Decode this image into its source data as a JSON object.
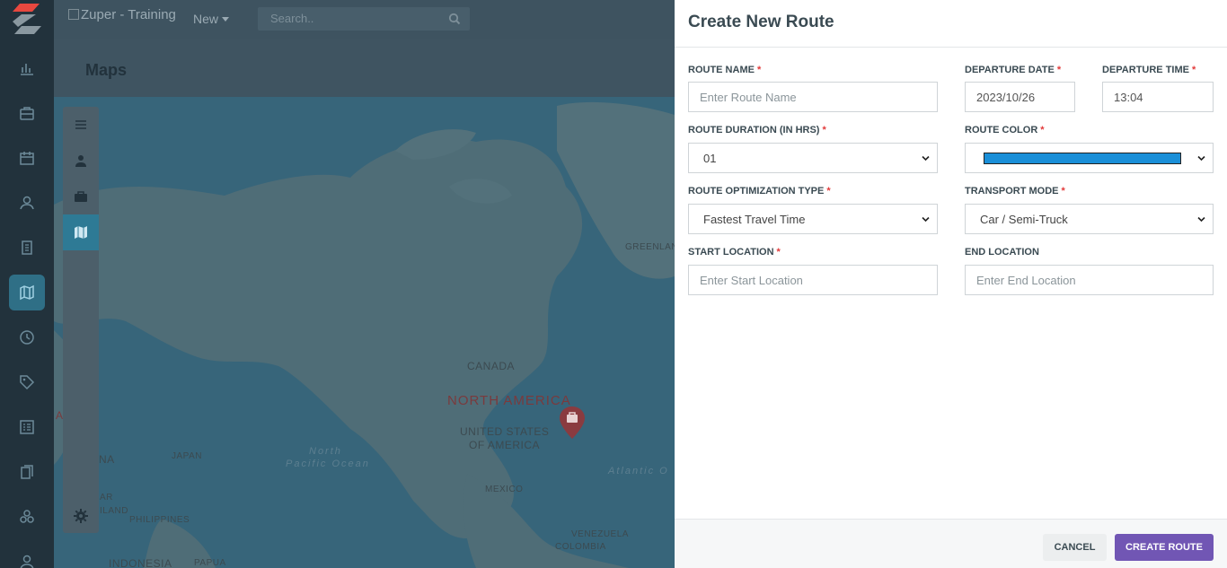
{
  "topbar": {
    "brand_alt": "Zuper - Training",
    "new_label": "New",
    "search_placeholder": "Search.."
  },
  "page": {
    "title": "Maps"
  },
  "map_labels": {
    "canada": "CANADA",
    "north_america": "NORTH AMERICA",
    "usa_line1": "UNITED STATES",
    "usa_line2": "OF AMERICA",
    "mexico": "MEXICO",
    "greenland": "GREENLAND",
    "north_pacific_1": "North",
    "north_pacific_2": "Pacific Ocean",
    "atlantic": "Atlantic O",
    "japan": "JAPAN",
    "philippines": "PHILIPPINES",
    "indonesia": "INDONESIA",
    "papua": "PAPUA",
    "venezuela": "VENEZUELA",
    "colombia": "COLOMBIA",
    "china_fragment": "NA",
    "a_fragment": "A",
    "ar_fragment": "AR",
    "iland_fragment": "ILAND"
  },
  "drawer": {
    "title": "Create New Route",
    "route_name": {
      "label": "ROUTE NAME",
      "placeholder": "Enter Route Name"
    },
    "departure_date": {
      "label": "DEPARTURE DATE",
      "value": "2023/10/26"
    },
    "departure_time": {
      "label": "DEPARTURE TIME",
      "value": "13:04"
    },
    "route_duration": {
      "label": "ROUTE DURATION (IN HRS)",
      "value": "01"
    },
    "route_color": {
      "label": "ROUTE COLOR",
      "value": "#1a8fd8"
    },
    "optimization": {
      "label": "ROUTE OPTIMIZATION TYPE",
      "value": "Fastest Travel Time"
    },
    "transport": {
      "label": "TRANSPORT MODE",
      "value": "Car / Semi-Truck"
    },
    "start_location": {
      "label": "START LOCATION",
      "placeholder": "Enter Start Location"
    },
    "end_location": {
      "label": "END LOCATION",
      "placeholder": "Enter End Location"
    },
    "required_mark": "*",
    "cancel_label": "CANCEL",
    "create_label": "CREATE ROUTE"
  },
  "colors": {
    "accent": "#7156b4",
    "active_nav": "#2f6f86"
  }
}
